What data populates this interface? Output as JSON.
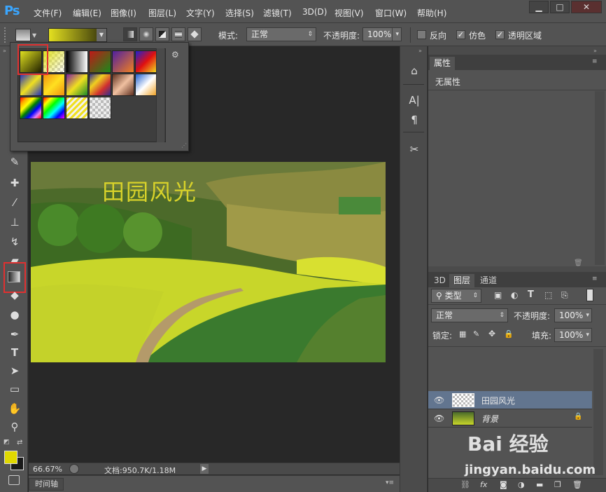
{
  "app": {
    "logo": "Ps"
  },
  "menu": [
    "文件(F)",
    "编辑(E)",
    "图像(I)",
    "图层(L)",
    "文字(Y)",
    "选择(S)",
    "滤镜(T)",
    "3D(D)",
    "视图(V)",
    "窗口(W)",
    "帮助(H)"
  ],
  "window_controls": {
    "minimize": "▁",
    "restore": "□",
    "close": "✕"
  },
  "options": {
    "mode_label": "模式:",
    "mode_value": "正常",
    "opacity_label": "不透明度:",
    "opacity_value": "100%",
    "reverse_label": "反向",
    "dither_label": "仿色",
    "transparency_label": "透明区域",
    "reverse_checked": false,
    "dither_checked": true,
    "transparency_checked": true
  },
  "picker": {
    "gear_icon": "gear-icon"
  },
  "canvas": {
    "overlay_text": "田园风光",
    "text_color": "#d8d22a"
  },
  "status": {
    "zoom": "66.67%",
    "doc_info": "文档:950.7K/1.18M"
  },
  "timeline": {
    "label": "时间轴"
  },
  "properties": {
    "tab": "属性",
    "content": "无属性"
  },
  "layers_panel": {
    "tabs": [
      "3D",
      "图层",
      "通道"
    ],
    "active_tab": "图层",
    "filter_label": "类型",
    "blend_mode": "正常",
    "opacity_label": "不透明度:",
    "opacity_value": "100%",
    "lock_label": "锁定:",
    "fill_label": "填充:",
    "fill_value": "100%",
    "layers": [
      {
        "name": "田园风光",
        "type": "text",
        "selected": true
      },
      {
        "name": "背景",
        "type": "image",
        "locked": true
      }
    ]
  },
  "colors": {
    "foreground": "#e0d800",
    "background": "#1a1a1a",
    "accent": "#3aa6ff",
    "highlight": "#e03030"
  },
  "watermark": {
    "brand": "Bai  经验",
    "url": "jingyan.baidu.com"
  }
}
